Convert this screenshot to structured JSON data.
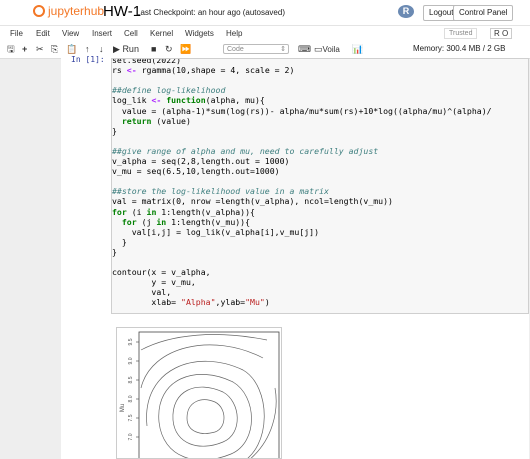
{
  "header": {
    "logo_text": "jupyterhub",
    "notebook_title": "HW-1",
    "checkpoint": "Last Checkpoint: an hour ago  (autosaved)",
    "kernel_logo": "R",
    "logout_label": "Logout",
    "control_panel_label": "Control Panel"
  },
  "menu": {
    "items": [
      "File",
      "Edit",
      "View",
      "Insert",
      "Cell",
      "Kernel",
      "Widgets",
      "Help"
    ],
    "trusted": "Trusted",
    "kernel_name": "R O"
  },
  "toolbar": {
    "run_label": "Run",
    "cell_type": "Code",
    "voila_label": "Voila",
    "memory": "Memory: 300.4 MB / 2 GB"
  },
  "cell": {
    "prompt": "In [1]:",
    "lines": [
      "set.seed(2022)",
      "rs <- rgamma(10,shape = 4, scale = 2)",
      "",
      "##define log-likelihood",
      "log_lik <- function(alpha, mu){",
      "  value = (alpha-1)*sum(log(rs))- alpha/mu*sum(rs)+10*log((alpha/mu)^(alpha)/",
      "  return (value)",
      "}",
      "",
      "##give range of alpha and mu, need to carefully adjust",
      "v_alpha = seq(2,8,length.out = 1000)",
      "v_mu = seq(6.5,10,length.out=1000)",
      "",
      "##store the log-likelihood value in a matrix",
      "val = matrix(0, nrow =length(v_alpha), ncol=length(v_mu))",
      "for (i in 1:length(v_alpha)){",
      "  for (j in 1:length(v_mu)){",
      "    val[i,j] = log_lik(v_alpha[i],v_mu[j])",
      "  }",
      "}",
      "",
      "contour(x = v_alpha,",
      "        y = v_mu,",
      "        val,",
      "        xlab= \"Alpha\",ylab=\"Mu\")"
    ]
  },
  "plot": {
    "ylabel": "Mu",
    "yticks": [
      "9.5",
      "9.0",
      "8.5",
      "8.0",
      "7.5",
      "7.0"
    ]
  },
  "colors": {
    "accent": "#f37726",
    "comment": "#408080",
    "keyword": "#008000",
    "string": "#ba2121",
    "prompt": "#303f9f"
  }
}
